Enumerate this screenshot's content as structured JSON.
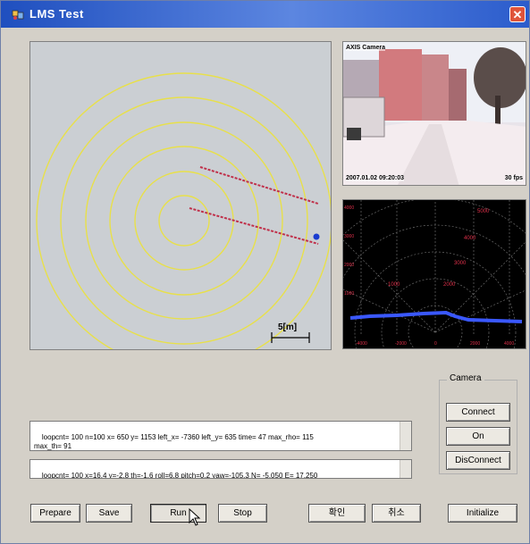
{
  "window": {
    "title": "LMS Test"
  },
  "camera": {
    "overlay_top": "AXIS Camera",
    "timestamp": "2007.01.02 09:20:03",
    "fps": "30 fps"
  },
  "radar": {
    "scale_label": "5[m]"
  },
  "polar": {
    "y_ticks": [
      "4000",
      "3000",
      "2000",
      "1000"
    ],
    "x_ticks": [
      "-4000",
      "-2000",
      "0",
      "2000",
      "4000"
    ],
    "ring_labels": [
      "5000",
      "4000",
      "3000",
      "2000",
      "1000"
    ]
  },
  "camera_group": {
    "label": "Camera",
    "connect_label": "Connect",
    "on_label": "On",
    "disconnect_label": "DisConnect"
  },
  "log": {
    "line1": "loopcnt= 100 n=100 x= 650 y= 1153 left_x= -7360 left_y= 635 time= 47 max_rho= 115\nmax_th= 91",
    "line2": "loopcnt= 100 x=16.4 y=-2.8 th=-1.6 roll=6.8 pitch=0.2 yaw=-105.3 N= -5,050 E= 17,250"
  },
  "toolbar": {
    "prepare_label": "Prepare",
    "save_label": "Save",
    "run_label": "Run",
    "stop_label": "Stop",
    "ok_label": "확인",
    "cancel_label": "취소",
    "initialize_label": "Initialize"
  },
  "colors": {
    "title_bar": "#2b5ccc",
    "radar_bg": "#cbcfd3",
    "ring": "#e8e04a",
    "scan_line": "#c0304a",
    "scan_blue": "#1a3cd0",
    "polar_grid": "#6a6a6a",
    "polar_scan": "#3a58ff",
    "polar_point": "#e0304a"
  },
  "icons": [
    "app-icon",
    "close-icon",
    "mouse-cursor-icon"
  ]
}
